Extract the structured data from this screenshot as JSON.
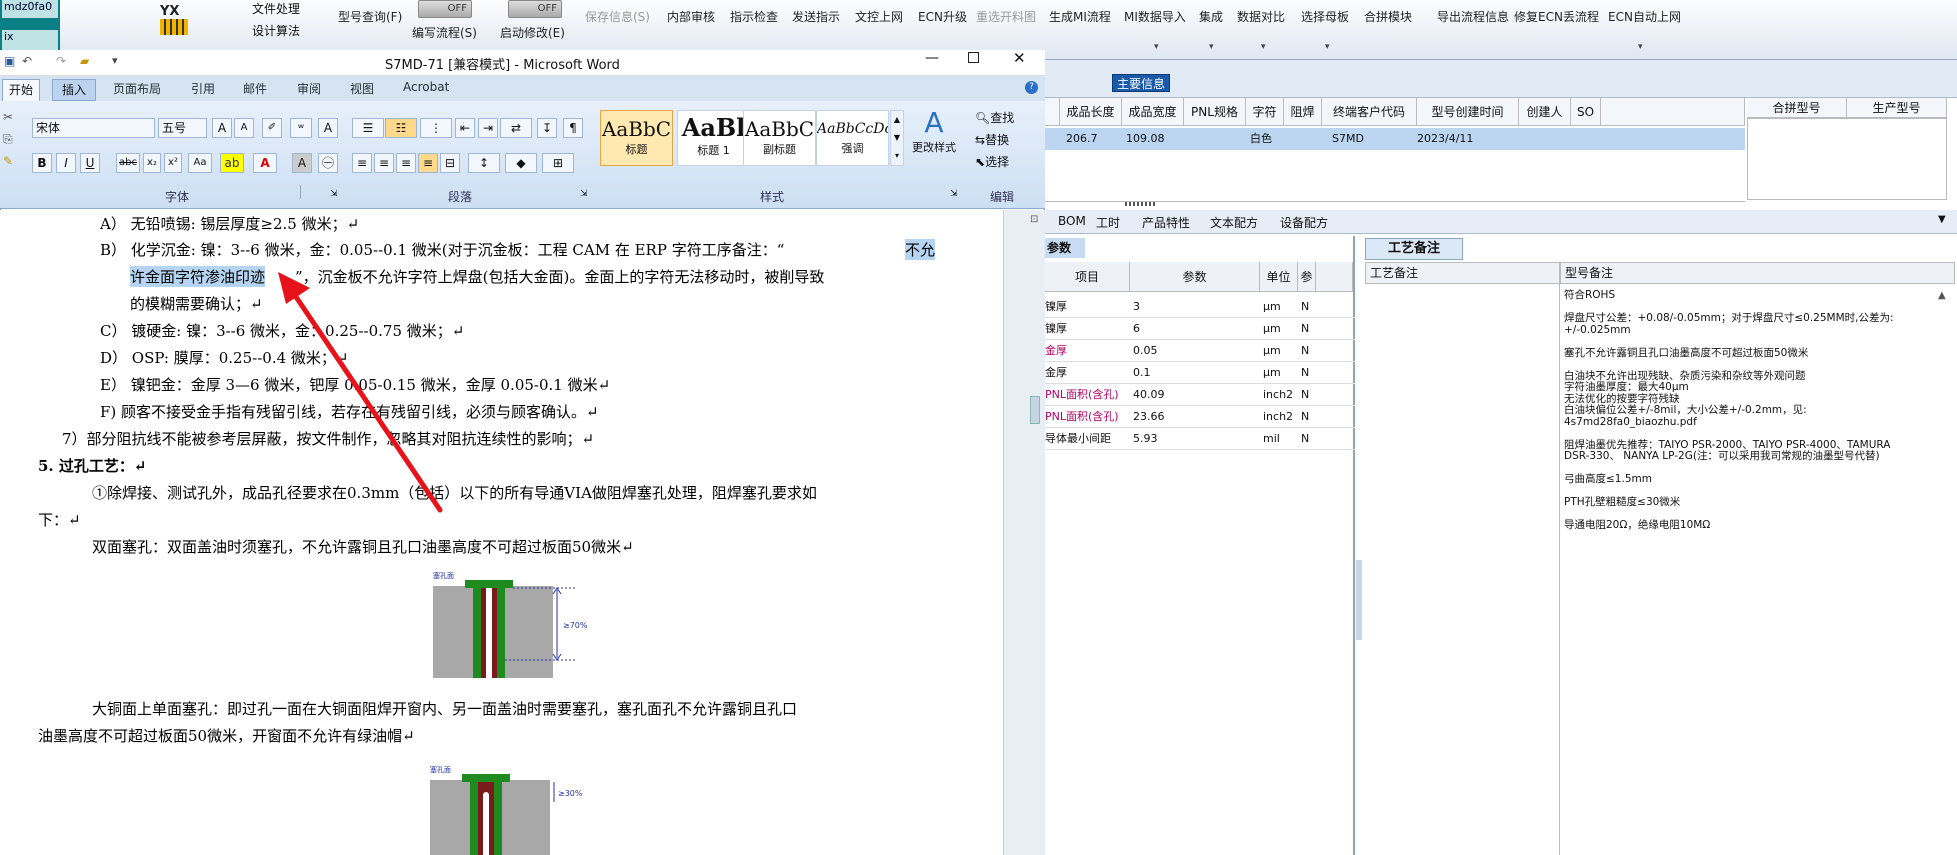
{
  "erp": {
    "left_strip": [
      "mdz0fa0",
      "ix",
      "n"
    ],
    "logo_text": "YX",
    "menu_items": [
      "文件处理",
      "设计算法"
    ],
    "toolbar": [
      {
        "label": "型号查询(F)",
        "disabled": false
      },
      {
        "label": "编写流程(S)",
        "disabled": false
      },
      {
        "label": "启动修改(E)",
        "disabled": false
      },
      {
        "label": "保存信息(S)",
        "disabled": true
      },
      {
        "label": "内部审核",
        "disabled": false
      },
      {
        "label": "指示检查",
        "disabled": false
      },
      {
        "label": "发送指示",
        "disabled": false
      },
      {
        "label": "文控上网",
        "disabled": false
      },
      {
        "label": "ECN升级",
        "disabled": false
      },
      {
        "label": "重选开料图",
        "disabled": true
      },
      {
        "label": "生成MI流程",
        "disabled": false
      },
      {
        "label": "MI数据导入",
        "disabled": false
      },
      {
        "label": "集成",
        "disabled": false
      },
      {
        "label": "数据对比",
        "disabled": false
      },
      {
        "label": "选择母板",
        "disabled": false
      },
      {
        "label": "合拼模块",
        "disabled": false
      },
      {
        "label": "导出流程信息",
        "disabled": false
      },
      {
        "label": "修复ECN丢流程",
        "disabled": false
      },
      {
        "label": "ECN自动上网",
        "disabled": false
      }
    ],
    "toggle_off": "OFF",
    "main_info_tab": "主要信息",
    "grid_headers": [
      "成品长度",
      "成品宽度",
      "PNL规格",
      "字符",
      "阻焊",
      "终端客户代码",
      "型号创建时间",
      "创建人",
      "SO"
    ],
    "grid_row": [
      "206.7",
      "109.08",
      "",
      "白色",
      "",
      "S7MD",
      "2023/4/11",
      "",
      ""
    ],
    "right_grid_headers": [
      "合拼型号",
      "生产型号"
    ],
    "sub_tabs": [
      "BOM",
      "工时",
      "产品特性",
      "文本配方",
      "设备配方"
    ],
    "param_tab": "参数",
    "param_headers": [
      "项目",
      "参数",
      "单位",
      "参"
    ],
    "param_rows": [
      {
        "item": "镍厚",
        "value": "3",
        "unit": "μm",
        "flag": "N",
        "pink": false
      },
      {
        "item": "镍厚",
        "value": "6",
        "unit": "μm",
        "flag": "N",
        "pink": false
      },
      {
        "item": "金厚",
        "value": "0.05",
        "unit": "μm",
        "flag": "N",
        "pink": true
      },
      {
        "item": "金厚",
        "value": "0.1",
        "unit": "μm",
        "flag": "N",
        "pink": false
      },
      {
        "item": "PNL面积(含孔)",
        "value": "40.09",
        "unit": "inch2",
        "flag": "N",
        "pink": true
      },
      {
        "item": "PNL面积(含孔)",
        "value": "23.66",
        "unit": "inch2",
        "flag": "N",
        "pink": true
      },
      {
        "item": "导体最小间距",
        "value": "5.93",
        "unit": "mil",
        "flag": "N",
        "pink": false
      }
    ],
    "remarks_tab": "工艺备注",
    "remarks_headers": [
      "工艺备注",
      "型号备注"
    ],
    "remarks_lines": [
      "符合ROHS",
      "",
      "焊盘尺寸公差：+0.08/-0.05mm；对于焊盘尺寸≤0.25MM时,公差为:",
      "+/-0.025mm",
      "",
      "塞孔不允许露铜且孔口油墨高度不可超过板面50微米",
      "",
      "白油块不允许出现残缺、杂质污染和杂纹等外观问题",
      "字符油墨厚度：最大40μm",
      "无法优化的按要字符残缺",
      "白油块偏位公差+/-8mil，大小公差+/-0.2mm，见:",
      "4s7md28fa0_biaozhu.pdf",
      "",
      "阻焊油墨优先推荐：TAIYO PSR-2000、TAIYO PSR-4000、TAMURA",
      "DSR-330、 NANYA LP-2G(注：可以采用我司常规的油墨型号代替)",
      "",
      "弓曲高度≤1.5mm",
      "",
      "PTH孔壁粗糙度≤30微米",
      "",
      "导通电阻20Ω，绝缘电阻10MΩ"
    ]
  },
  "word": {
    "title": "S7MD-71 [兼容模式] - Microsoft Word",
    "tabs": [
      "开始",
      "插入",
      "页面布局",
      "引用",
      "邮件",
      "审阅",
      "视图",
      "Acrobat"
    ],
    "font_name": "宋体",
    "font_size": "五号",
    "groups": [
      "字体",
      "段落",
      "样式",
      "编辑"
    ],
    "styles": [
      {
        "preview": "AaBbC",
        "name": "标题"
      },
      {
        "preview": "AaBl",
        "name": "标题 1"
      },
      {
        "preview": "AaBbC",
        "name": "副标题"
      },
      {
        "preview": "AaBbCcDc",
        "name": "强调"
      }
    ],
    "change_styles": "更改样式",
    "edit_items": [
      "查找",
      "替换",
      "选择"
    ],
    "lines": [
      "A） 无铅喷锡:   锡层厚度≥2.5 微米；↵",
      "B） 化学沉金:   镍：3--6 微米，金：0.05--0.1 微米(对于沉金板：工程 CAM 在 ERP 字符工序备注：“",
      "不允",
      "许金面字符渗油印迹",
      "”，沉金板不允许字符上焊盘(包括大金面)。金面上的字符无法移动时，被削导致",
      "的模糊需要确认；↵",
      "C） 镀硬金:      镍：3--6 微米，金：0.25--0.75 微米；↵",
      "D） OSP:         膜厚：0.25--0.4 微米；↵",
      "E） 镍钯金：金厚 3—6 微米，钯厚 0.05-0.15 微米，金厚 0.05-0.1 微米↵",
      "F) 顾客不接受金手指有残留引线，若存在有残留引线，必须与顾客确认。↵",
      "7）部分阻抗线不能被参考层屏蔽，按文件制作，忽略其对阻抗连续性的影响；↵",
      "5.   过孔工艺：↵",
      "①除焊接、测试孔外，成品孔径要求在0.3mm（包括）以下的所有导通VIA做阻焊塞孔处理，阻焊塞孔要求如",
      "下：↵",
      "双面塞孔：双面盖油时须塞孔，不允许露铜且孔口油墨高度不可超过板面50微米↵",
      "大铜面上单面塞孔：即过孔一面在大铜面阻焊开窗内、另一面盖油时需要塞孔，塞孔面孔不允许露铜且孔口",
      "油墨高度不可超过板面50微米，开窗面不允许有绿油帽↵"
    ],
    "fig1_label": "≥70%",
    "fig2_label": "≥30%",
    "fig_tag": "塞孔面"
  },
  "colors": {
    "accent_blue": "#1b5aa8",
    "selection": "#b5d4f2",
    "arrow": "#e8121a",
    "via_green": "#1f8a1f"
  }
}
